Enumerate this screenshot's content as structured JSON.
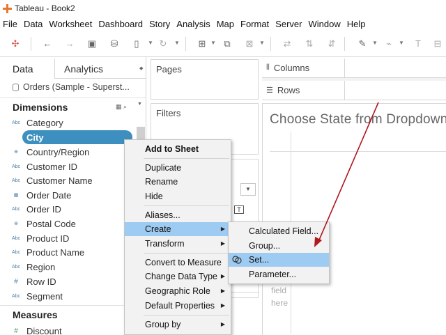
{
  "window": {
    "title": "Tableau - Book2"
  },
  "menubar": [
    "File",
    "Data",
    "Worksheet",
    "Dashboard",
    "Story",
    "Analysis",
    "Map",
    "Format",
    "Server",
    "Window",
    "Help"
  ],
  "left_pane": {
    "tabs": [
      "Data",
      "Analytics"
    ],
    "datasource": "Orders (Sample - Superst...",
    "dimensions_header": "Dimensions",
    "dimensions": [
      {
        "label": "Category",
        "icon": "Abc"
      },
      {
        "label": "City",
        "icon": "globe"
      },
      {
        "label": "Country/Region",
        "icon": "globe"
      },
      {
        "label": "Customer ID",
        "icon": "Abc"
      },
      {
        "label": "Customer Name",
        "icon": "Abc"
      },
      {
        "label": "Order Date",
        "icon": "calendar"
      },
      {
        "label": "Order ID",
        "icon": "Abc"
      },
      {
        "label": "Postal Code",
        "icon": "globe"
      },
      {
        "label": "Product ID",
        "icon": "Abc"
      },
      {
        "label": "Product Name",
        "icon": "Abc"
      },
      {
        "label": "Region",
        "icon": "Abc"
      },
      {
        "label": "Row ID",
        "icon": "#"
      },
      {
        "label": "Segment",
        "icon": "Abc"
      }
    ],
    "measures_header": "Measures",
    "measures": [
      {
        "label": "Discount",
        "icon": "#"
      }
    ]
  },
  "cards": {
    "pages": "Pages",
    "filters": "Filters"
  },
  "shelves": {
    "columns": "Columns",
    "rows": "Rows"
  },
  "view": {
    "title": "Choose State from Dropdown",
    "drop_hint": [
      "field",
      "here"
    ]
  },
  "context_menu": {
    "items": [
      "Add to Sheet",
      "Duplicate",
      "Rename",
      "Hide",
      "Aliases...",
      "Create",
      "Transform",
      "Convert to Measure",
      "Change Data Type",
      "Geographic Role",
      "Default Properties",
      "Group by"
    ]
  },
  "create_submenu": {
    "items": [
      "Calculated Field...",
      "Group...",
      "Set...",
      "Parameter..."
    ]
  },
  "colors": {
    "selected_pill": "#3c8fbf",
    "menu_highlight": "#9ecbf2",
    "annotation_arrow": "#b0171f"
  }
}
